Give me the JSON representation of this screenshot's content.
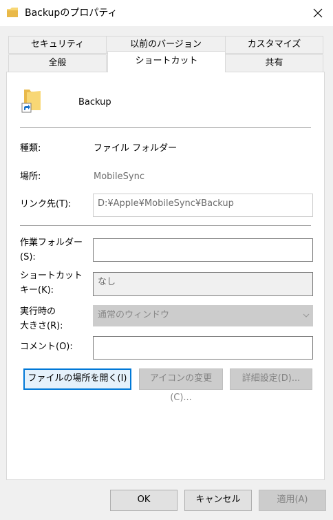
{
  "window": {
    "title": "Backupのプロパティ"
  },
  "tabs_row1": [
    {
      "label": "セキュリティ"
    },
    {
      "label": "以前のバージョン"
    },
    {
      "label": "カスタマイズ"
    }
  ],
  "tabs_row2": [
    {
      "label": "全般"
    },
    {
      "label": "ショートカット",
      "active": true
    },
    {
      "label": "共有"
    }
  ],
  "shortcut": {
    "name": "Backup",
    "type_label": "種類:",
    "type_value": "ファイル フォルダー",
    "location_label": "場所:",
    "location_value": "MobileSync",
    "target_label": "リンク先(T):",
    "target_value": "D:¥Apple¥MobileSync¥Backup",
    "workdir_label_1": "作業フォルダー",
    "workdir_label_2": "(S):",
    "workdir_value": "",
    "hotkey_label_1": "ショートカット",
    "hotkey_label_2": "キー(K):",
    "hotkey_value": "なし",
    "run_label_1": "実行時の",
    "run_label_2": "大きさ(R):",
    "run_value": "通常のウィンドウ",
    "comment_label": "コメント(O):",
    "comment_value": "",
    "open_location_button": "ファイルの場所を開く(I)",
    "change_icon_button": "アイコンの変更(C)...",
    "advanced_button": "詳細設定(D)..."
  },
  "footer": {
    "ok": "OK",
    "cancel": "キャンセル",
    "apply": "適用(A)"
  },
  "colors": {
    "accent": "#0078d7",
    "folder": "#f8d775",
    "shortcut_arrow": "#1d73c9"
  }
}
